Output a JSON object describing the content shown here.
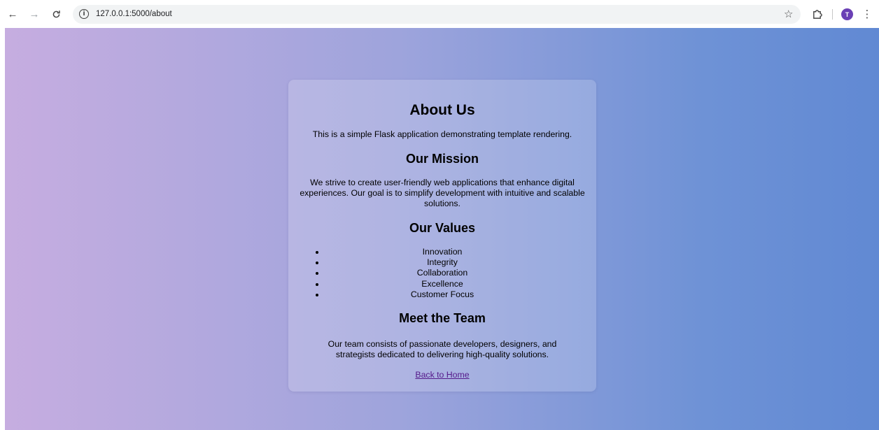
{
  "browser": {
    "url": "127.0.0.1:5000/about",
    "profile_initial": "T"
  },
  "page": {
    "title": "About Us",
    "intro": "This is a simple Flask application demonstrating template rendering.",
    "mission": {
      "title": "Our Mission",
      "text": "We strive to create user-friendly web applications that enhance digital experiences. Our goal is to simplify development with intuitive and scalable solutions."
    },
    "values": {
      "title": "Our Values",
      "items": [
        "Innovation",
        "Integrity",
        "Collaboration",
        "Excellence",
        "Customer Focus"
      ]
    },
    "team": {
      "title": "Meet the Team",
      "text": "Our team consists of passionate developers, designers, and strategists dedicated to delivering high-quality solutions."
    },
    "back_link": "Back to Home"
  },
  "icons": {
    "back": "arrow-left-icon",
    "forward": "arrow-right-icon",
    "reload": "reload-icon",
    "site_info": "info-icon",
    "bookmark": "star-icon",
    "extensions": "puzzle-icon",
    "menu": "kebab-menu-icon"
  },
  "colors": {
    "gradient_start": "#c6ade0",
    "gradient_end": "#6189d3",
    "link": "#551a8b",
    "avatar": "#6a3fb5"
  }
}
